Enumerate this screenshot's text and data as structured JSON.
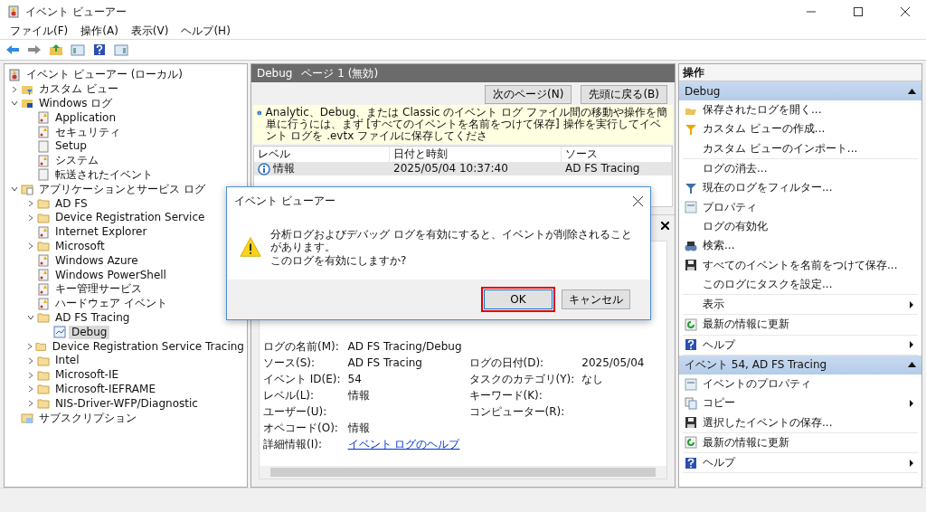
{
  "window": {
    "title": "イベント ビューアー"
  },
  "menu": [
    "ファイル(F)",
    "操作(A)",
    "表示(V)",
    "ヘルプ(H)"
  ],
  "toolbar": [
    {
      "kind": "back"
    },
    {
      "kind": "forward"
    },
    {
      "kind": "up"
    },
    {
      "kind": "panel-left"
    },
    {
      "kind": "help"
    },
    {
      "kind": "panel-right"
    }
  ],
  "tree": [
    {
      "label": "イベント ビューアー (ローカル)",
      "kind": "viewer",
      "selected": false,
      "children": [
        {
          "label": "カスタム ビュー",
          "kind": "custom",
          "selected": false,
          "expanded": false
        },
        {
          "label": "Windows ログ",
          "kind": "windows",
          "selected": false,
          "expanded": true,
          "children": [
            {
              "label": "Application",
              "kind": "log",
              "selected": false
            },
            {
              "label": "セキュリティ",
              "kind": "log",
              "selected": false
            },
            {
              "label": "Setup",
              "kind": "blank",
              "selected": false
            },
            {
              "label": "システム",
              "kind": "log",
              "selected": false
            },
            {
              "label": "転送されたイベント",
              "kind": "blank",
              "selected": false
            }
          ]
        },
        {
          "label": "アプリケーションとサービス ログ",
          "kind": "apps",
          "selected": false,
          "expanded": true,
          "children": [
            {
              "label": "AD FS",
              "kind": "folder",
              "selected": false,
              "expanded": false
            },
            {
              "label": "Device Registration Service",
              "kind": "folder",
              "selected": false,
              "expanded": false
            },
            {
              "label": "Internet Explorer",
              "kind": "log",
              "selected": false
            },
            {
              "label": "Microsoft",
              "kind": "folder",
              "selected": false,
              "expanded": false
            },
            {
              "label": "Windows Azure",
              "kind": "log",
              "selected": false
            },
            {
              "label": "Windows PowerShell",
              "kind": "log",
              "selected": false
            },
            {
              "label": "キー管理サービス",
              "kind": "log",
              "selected": false
            },
            {
              "label": "ハードウェア イベント",
              "kind": "log",
              "selected": false
            },
            {
              "label": "AD FS Tracing",
              "kind": "folder",
              "selected": false,
              "expanded": true,
              "children": [
                {
                  "label": "Debug",
                  "kind": "debug",
                  "selected": true
                }
              ]
            },
            {
              "label": "Device Registration Service Tracing",
              "kind": "folder",
              "selected": false,
              "expanded": false
            },
            {
              "label": "Intel",
              "kind": "folder",
              "selected": false,
              "expanded": false
            },
            {
              "label": "Microsoft-IE",
              "kind": "folder",
              "selected": false,
              "expanded": false
            },
            {
              "label": "Microsoft-IEFRAME",
              "kind": "folder",
              "selected": false,
              "expanded": false
            },
            {
              "label": "NIS-Driver-WFP/Diagnostic",
              "kind": "folder",
              "selected": false,
              "expanded": false
            }
          ]
        },
        {
          "label": "サブスクリプション",
          "kind": "subscription",
          "selected": false
        }
      ]
    }
  ],
  "center": {
    "title": "Debug",
    "subtitle": "ページ 1 (無効)",
    "buttons": [
      "次のページ(N)",
      "先頭に戻る(B)"
    ],
    "info": "Analytic、Debug、または Classic のイベント ログ ファイル間の移動や操作を簡単に行うには、まず [すべてのイベントを名前をつけて保存] 操作を実行してイベント ログを .evtx ファイルに保存してくださ",
    "columns": [
      "レベル",
      "日付と時刻",
      "ソース"
    ],
    "rows": [
      {
        "level": "情報",
        "date": "2025/05/04 10:37:40",
        "source": "AD FS Tracing",
        "selected": true
      }
    ],
    "details": [
      {
        "label": "ログの名前(M):",
        "value": "AD FS Tracing/Debug"
      },
      {
        "label": "ソース(S):",
        "value": "AD FS Tracing",
        "label_2": "ログの日付(D):",
        "value_2": "2025/05/04"
      },
      {
        "label": "イベント ID(E):",
        "value": "54",
        "label_2": "タスクのカテゴリ(Y):",
        "value_2": "なし"
      },
      {
        "label": "レベル(L):",
        "value": "情報",
        "label_2": "キーワード(K):"
      },
      {
        "label": "ユーザー(U):",
        "label_2": "コンピューター(R):"
      },
      {
        "label": "オペコード(O):",
        "value": "情報"
      },
      {
        "label": "詳細情報(I):",
        "link": "イベント ログのヘルプ"
      }
    ]
  },
  "actions": {
    "title": "操作",
    "sections": [
      {
        "title": "Debug",
        "groups": [
          [
            {
              "label": "保存されたログを開く...",
              "kind": "open"
            },
            {
              "label": "カスタム ビューの作成...",
              "kind": "funnel"
            },
            {
              "label": "カスタム ビューのインポート..."
            }
          ],
          [
            {
              "label": "ログの消去..."
            },
            {
              "label": "現在のログをフィルター...",
              "kind": "filter"
            },
            {
              "label": "プロパティ",
              "kind": "props"
            },
            {
              "label": "ログの有効化"
            },
            {
              "label": "検索...",
              "kind": "find"
            },
            {
              "label": "すべてのイベントを名前をつけて保存...",
              "kind": "save"
            },
            {
              "label": "このログにタスクを設定..."
            }
          ],
          [
            {
              "label": "表示",
              "submenu": true
            }
          ],
          [
            {
              "label": "最新の情報に更新",
              "kind": "refresh"
            }
          ],
          [
            {
              "label": "ヘルプ",
              "kind": "help",
              "submenu": true
            }
          ]
        ]
      },
      {
        "title": "イベント 54, AD FS Tracing",
        "groups": [
          [
            {
              "label": "イベントのプロパティ",
              "kind": "props"
            },
            {
              "label": "コピー",
              "kind": "copy",
              "submenu": true
            },
            {
              "label": "選択したイベントの保存...",
              "kind": "save"
            }
          ],
          [
            {
              "label": "最新の情報に更新",
              "kind": "refresh"
            }
          ],
          [
            {
              "label": "ヘルプ",
              "kind": "help",
              "submenu": true
            }
          ]
        ]
      }
    ]
  },
  "dialog": {
    "title": "イベント ビューアー",
    "message": [
      "分析ログおよびデバッグ ログを有効にすると、イベントが削除されることがあります。",
      "このログを有効にしますか?"
    ],
    "buttons": [
      {
        "label": "OK",
        "selected": true
      },
      {
        "label": "キャンセル",
        "selected": false
      }
    ]
  }
}
